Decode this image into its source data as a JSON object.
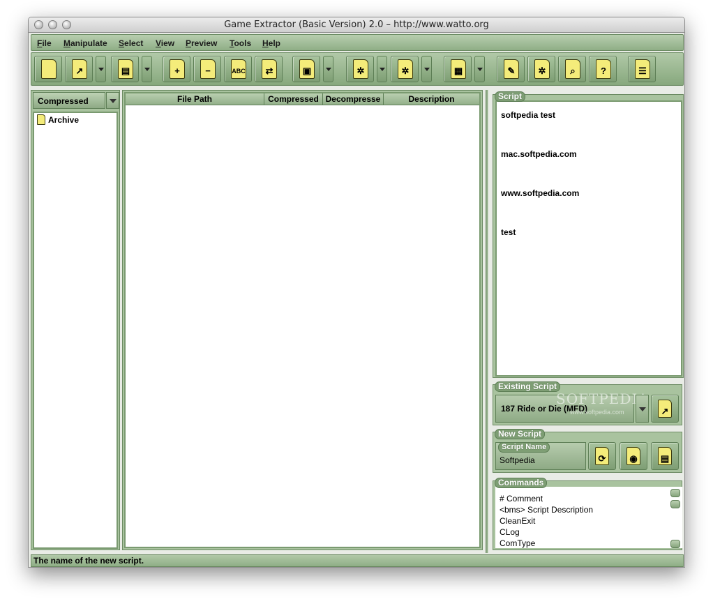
{
  "window": {
    "title": "Game Extractor (Basic Version) 2.0 – http://www.watto.org"
  },
  "menu": [
    {
      "label": "File",
      "hotkey": "F"
    },
    {
      "label": "Manipulate",
      "hotkey": "M"
    },
    {
      "label": "Select",
      "hotkey": "S"
    },
    {
      "label": "View",
      "hotkey": "V"
    },
    {
      "label": "Preview",
      "hotkey": "P"
    },
    {
      "label": "Tools",
      "hotkey": "T"
    },
    {
      "label": "Help",
      "hotkey": "H"
    }
  ],
  "toolbar": {
    "buttons": [
      {
        "name": "new-archive-icon",
        "glyph": ""
      },
      {
        "name": "open-archive-icon",
        "glyph": "↗"
      },
      {
        "name": "save-archive-icon",
        "glyph": "▤"
      },
      {
        "name": "add-files-icon",
        "glyph": "+"
      },
      {
        "name": "remove-files-icon",
        "glyph": "−"
      },
      {
        "name": "rename-files-icon",
        "glyph": "ABC"
      },
      {
        "name": "replace-files-icon",
        "glyph": "⇄"
      },
      {
        "name": "export-files-icon",
        "glyph": "▣"
      },
      {
        "name": "extract-selected-icon",
        "glyph": "✲"
      },
      {
        "name": "extract-all-icon",
        "glyph": "✲"
      },
      {
        "name": "table-view-icon",
        "glyph": "▦"
      },
      {
        "name": "write-script-icon",
        "glyph": "✎"
      },
      {
        "name": "plugins-icon",
        "glyph": "✲"
      },
      {
        "name": "search-icon",
        "glyph": "⌕"
      },
      {
        "name": "help-icon",
        "glyph": "?"
      },
      {
        "name": "options-icon",
        "glyph": "☰"
      }
    ],
    "accent": "#87a87d"
  },
  "left_panel": {
    "combo_value": "Compressed",
    "tree": [
      {
        "label": "Archive"
      }
    ]
  },
  "file_table": {
    "columns": [
      "File Path",
      "Compressed",
      "Decompresse",
      "Description"
    ],
    "rows": []
  },
  "script": {
    "label": "Script",
    "lines": [
      "softpedia test",
      "mac.softpedia.com",
      "www.softpedia.com",
      "test"
    ]
  },
  "existing_script": {
    "label": "Existing Script",
    "selected": "187 Ride or Die (MFD)",
    "watermark": "SOFTPEDIA",
    "watermark_sub": "www.softpedia.com"
  },
  "new_script": {
    "label": "New Script",
    "name_label": "Script Name",
    "name_value": "Softpedia"
  },
  "commands": {
    "label": "Commands",
    "items": [
      "# Comment",
      "<bms> Script Description",
      "CleanExit",
      "CLog",
      "ComType"
    ]
  },
  "status": {
    "text": "The name of the new script."
  }
}
